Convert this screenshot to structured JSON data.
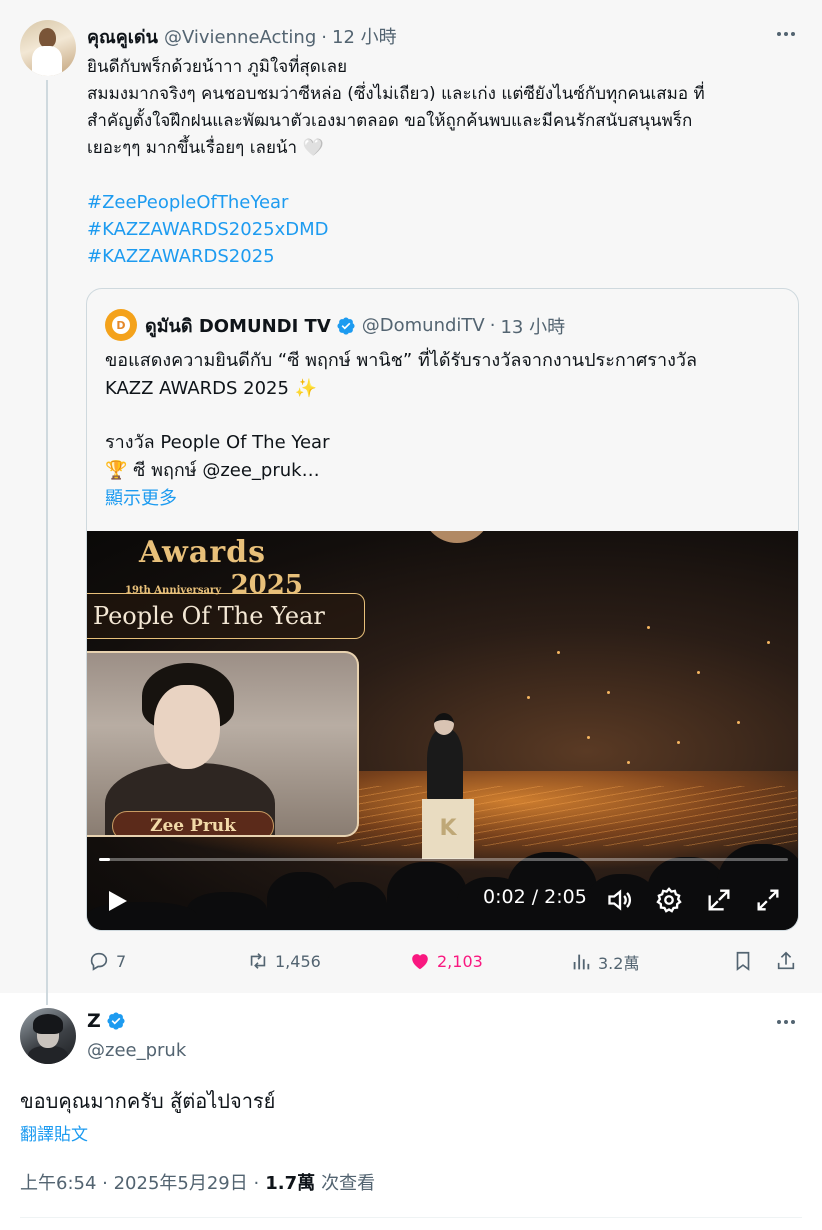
{
  "parent_tweet": {
    "author_name": "คุณคูเด่น",
    "author_handle": "@VivienneActing",
    "time": "12 小時",
    "text_lines": [
      "ยินดีกับพร็กด้วยน้าาา ภูมิใจที่สุดเลย",
      "สมมงมากจริงๆ คนชอบชมว่าซีหล่อ (ซึ่งไม่เถียว) และเก่ง แต่ซียังไนซ์กับทุกคนเสมอ ที่",
      "สำคัญตั้งใจฝึกฝนและพัฒนาตัวเองมาตลอด ขอให้ถูกค้นพบและมีคนรักสนับสนุนพร็ก",
      "เยอะๆๆ มากขึ้นเรื่อยๆ เลยน้า 🤍"
    ],
    "hashtags": [
      "#ZeePeopleOfTheYear",
      "#KAZZAWARDS2025xDMD",
      "#KAZZAWARDS2025"
    ],
    "quote": {
      "author_name": "ดูมันดิ DOMUNDI TV",
      "author_handle": "@DomundiTV",
      "time": "13 小時",
      "avatar_letter": "D",
      "lines": [
        "ขอแสดงความยินดีกับ “ซี พฤกษ์ พานิช” ที่ได้รับรางวัลจากงานประกาศรางวัล",
        "KAZZ AWARDS 2025 ✨",
        "รางวัล People Of The Year",
        "🏆 ซี พฤกษ์ @zee_pruk…"
      ],
      "show_more": "顯示更多",
      "video": {
        "logo_line1": "Awards",
        "logo_anniv": "19th Anniversary",
        "logo_year": "2025",
        "banner": "People Of The Year",
        "name_plate": "Zee Pruk",
        "podium_letter": "K",
        "time_display": "0:02 / 2:05",
        "progress": 0.016
      }
    },
    "stats": {
      "replies": "7",
      "reposts": "1,456",
      "likes": "2,103",
      "views": "3.2萬"
    }
  },
  "reply_tweet": {
    "author_name": "Z",
    "author_handle": "@zee_pruk",
    "text": "ขอบคุณมากครับ สู้ต่อไปจารย์",
    "translate": "翻譯貼文",
    "timestamp": "上午6:54 · 2025年5月29日 ·",
    "views_count": "1.7萬",
    "views_label": "次查看"
  },
  "colors": {
    "accent": "#1d9bf0",
    "like": "#f91880",
    "secondary_text": "#536471",
    "parent_background": "#f7f7f7"
  }
}
